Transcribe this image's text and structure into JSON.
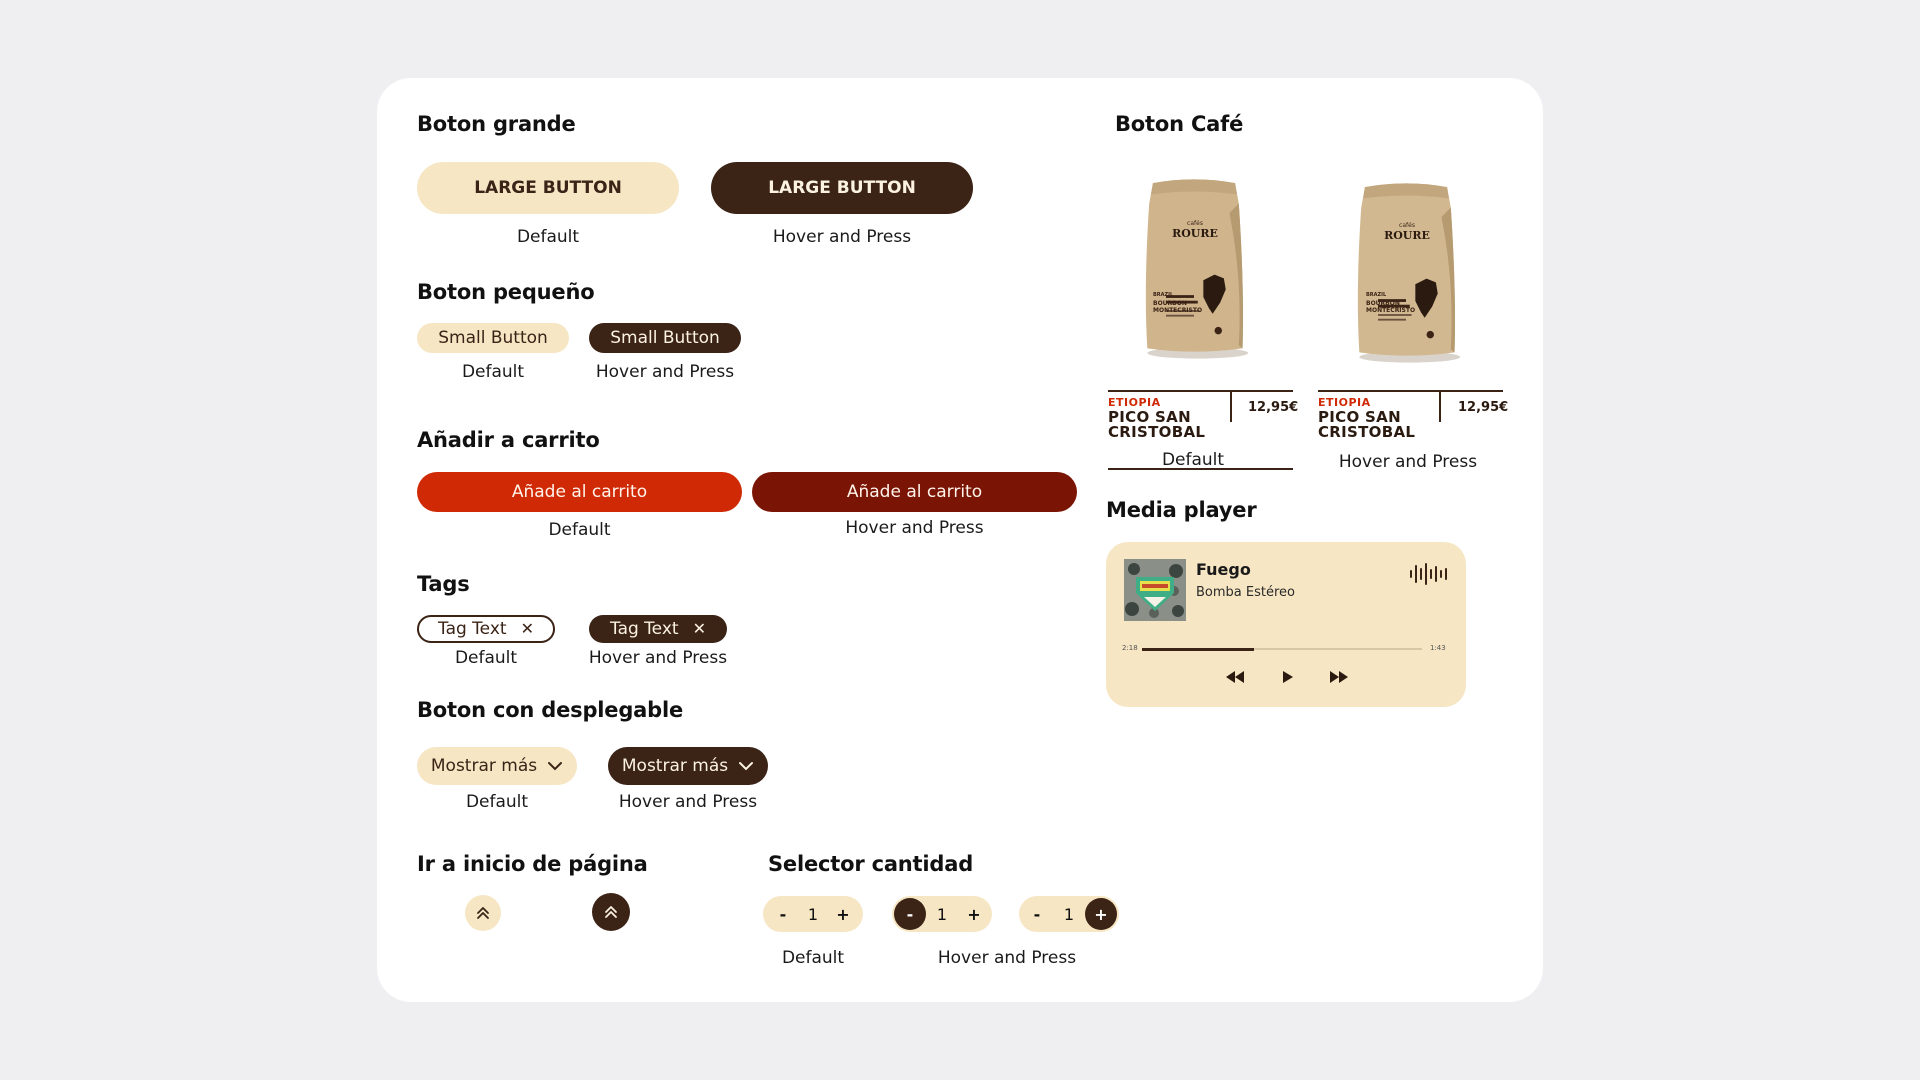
{
  "sections": {
    "large_button": {
      "title": "Boton grande",
      "default_label": "LARGE BUTTON",
      "hover_label": "LARGE BUTTON",
      "default_caption": "Default",
      "hover_caption": "Hover and Press"
    },
    "small_button": {
      "title": "Boton pequeño",
      "default_label": "Small Button",
      "hover_label": "Small Button",
      "default_caption": "Default",
      "hover_caption": "Hover and Press"
    },
    "add_to_cart": {
      "title": "Añadir a carrito",
      "default_label": "Añade al carrito",
      "hover_label": "Añade al carrito",
      "default_caption": "Default",
      "hover_caption": "Hover and Press"
    },
    "tags": {
      "title": "Tags",
      "default_label": "Tag Text",
      "hover_label": "Tag Text",
      "default_caption": "Default",
      "hover_caption": "Hover and Press"
    },
    "dropdown": {
      "title": "Boton con desplegable",
      "default_label": "Mostrar más",
      "hover_label": "Mostrar más",
      "default_caption": "Default",
      "hover_caption": "Hover and Press"
    },
    "back_to_top": {
      "title": "Ir a inicio de página"
    },
    "quantity": {
      "title": "Selector cantidad",
      "minus": "-",
      "plus": "+",
      "value": "1",
      "default_caption": "Default",
      "hover_caption": "Hover and Press"
    },
    "coffee": {
      "title": "Boton Café",
      "brand_small": "cafés",
      "brand": "ROURE",
      "bag_origin": "BRAZIL",
      "bag_name": "BOURBON MONTECRISTO",
      "cards": [
        {
          "origin": "ETIOPIA",
          "name_line1": "PICO SAN",
          "name_line2": "CRISTOBAL",
          "price": "12,95€",
          "caption": "Default"
        },
        {
          "origin": "ETIOPIA",
          "name_line1": "PICO SAN",
          "name_line2": "CRISTOBAL",
          "price": "12,95€",
          "caption": "Hover and Press"
        }
      ]
    },
    "media_player": {
      "title": "Media player",
      "track": "Fuego",
      "artist": "Bomba Estéreo",
      "elapsed": "2:18",
      "remaining": "1:43",
      "progress": 0.4
    }
  },
  "colors": {
    "cream": "#f6e6c4",
    "dark_brown": "#3b2316",
    "red": "#cf2a05",
    "maroon": "#7a1505"
  },
  "icons": [
    "close-icon",
    "chevron-down-icon",
    "double-chevron-up-icon",
    "rewind-icon",
    "play-icon",
    "fast-forward-icon",
    "audio-wave-icon"
  ]
}
